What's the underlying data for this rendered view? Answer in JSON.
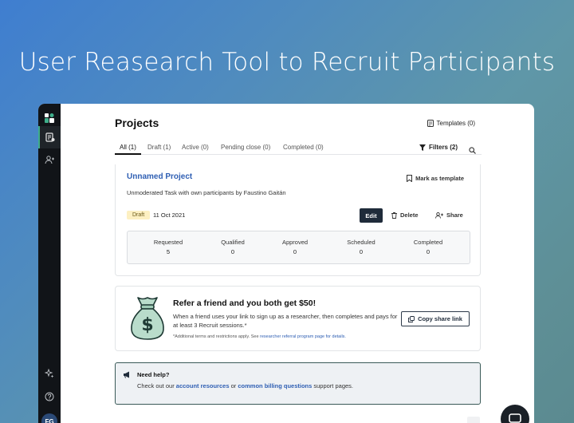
{
  "hero": {
    "title": "User Reasearch Tool to Recruit Participants"
  },
  "sidebar": {
    "avatar_initials": "FG"
  },
  "header": {
    "title": "Projects",
    "templates_label": "Templates (0)"
  },
  "tabs": {
    "items": [
      {
        "label": "All (1)"
      },
      {
        "label": "Draft (1)"
      },
      {
        "label": "Active (0)"
      },
      {
        "label": "Pending close (0)"
      },
      {
        "label": "Completed (0)"
      }
    ],
    "filters_label": "Filters (2)"
  },
  "project": {
    "title": "Unnamed Project",
    "subtitle": "Unmoderated Task with own participants by Faustino Gaitán",
    "mark_template_label": "Mark as template",
    "status_badge": "Draft",
    "date": "11 Oct 2021",
    "edit_label": "Edit",
    "delete_label": "Delete",
    "share_label": "Share",
    "stats": [
      {
        "label": "Requested",
        "value": "5"
      },
      {
        "label": "Qualified",
        "value": "0"
      },
      {
        "label": "Approved",
        "value": "0"
      },
      {
        "label": "Scheduled",
        "value": "0"
      },
      {
        "label": "Completed",
        "value": "0"
      }
    ]
  },
  "referral": {
    "title": "Refer a friend and you both get $50!",
    "body": "When a friend uses your link to sign up as a researcher, then completes and pays for at least 3 Recruit sessions.*",
    "fine_print": "*Additional terms and restrictions apply. See",
    "fine_link": "researcher referral program page for details.",
    "copy_label": "Copy share link",
    "bag_symbol": "$"
  },
  "help": {
    "title": "Need help?",
    "prefix": "Check out our",
    "link1": "account resources",
    "middle": "or",
    "link2": "common billing questions",
    "suffix": "support pages."
  },
  "colors": {
    "accent_blue": "#2f5fb3",
    "dark": "#1f2937",
    "badge_bg": "#fdf0c2",
    "bag_green": "#b9dccb",
    "bag_stroke": "#1e3a34"
  }
}
